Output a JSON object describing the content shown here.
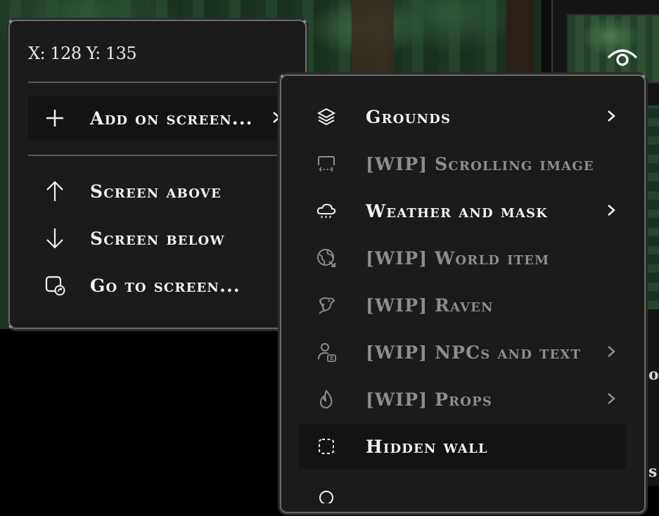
{
  "coords": {
    "text": "X: 128 Y: 135"
  },
  "left_menu": {
    "add_on_screen": "Add on screen...",
    "screen_above": "Screen above",
    "screen_below": "Screen below",
    "go_to_screen": "Go to screen..."
  },
  "submenu": {
    "items": [
      {
        "label": "Grounds",
        "icon": "layers-icon",
        "enabled": true,
        "has_submenu": true
      },
      {
        "label": "[WIP] Scrolling image",
        "icon": "scroll-image-icon",
        "enabled": false,
        "has_submenu": false
      },
      {
        "label": "Weather and mask",
        "icon": "cloud-rain-icon",
        "enabled": true,
        "has_submenu": true
      },
      {
        "label": "[WIP] World item",
        "icon": "globe-icon",
        "enabled": false,
        "has_submenu": false
      },
      {
        "label": "[WIP] Raven",
        "icon": "bird-icon",
        "enabled": false,
        "has_submenu": false
      },
      {
        "label": "[WIP] NPCs and text",
        "icon": "person-text-icon",
        "enabled": false,
        "has_submenu": true
      },
      {
        "label": "[WIP] Props",
        "icon": "flame-icon",
        "enabled": false,
        "has_submenu": true
      },
      {
        "label": "Hidden wall",
        "icon": "dashed-square-icon",
        "enabled": true,
        "has_submenu": false
      }
    ]
  },
  "colors": {
    "menu_bg": "#1b1b1b",
    "menu_border": "#6a6a6a",
    "text": "#f2f2f2",
    "text_disabled": "#8d8d8d",
    "highlight_bg": "#131313"
  }
}
